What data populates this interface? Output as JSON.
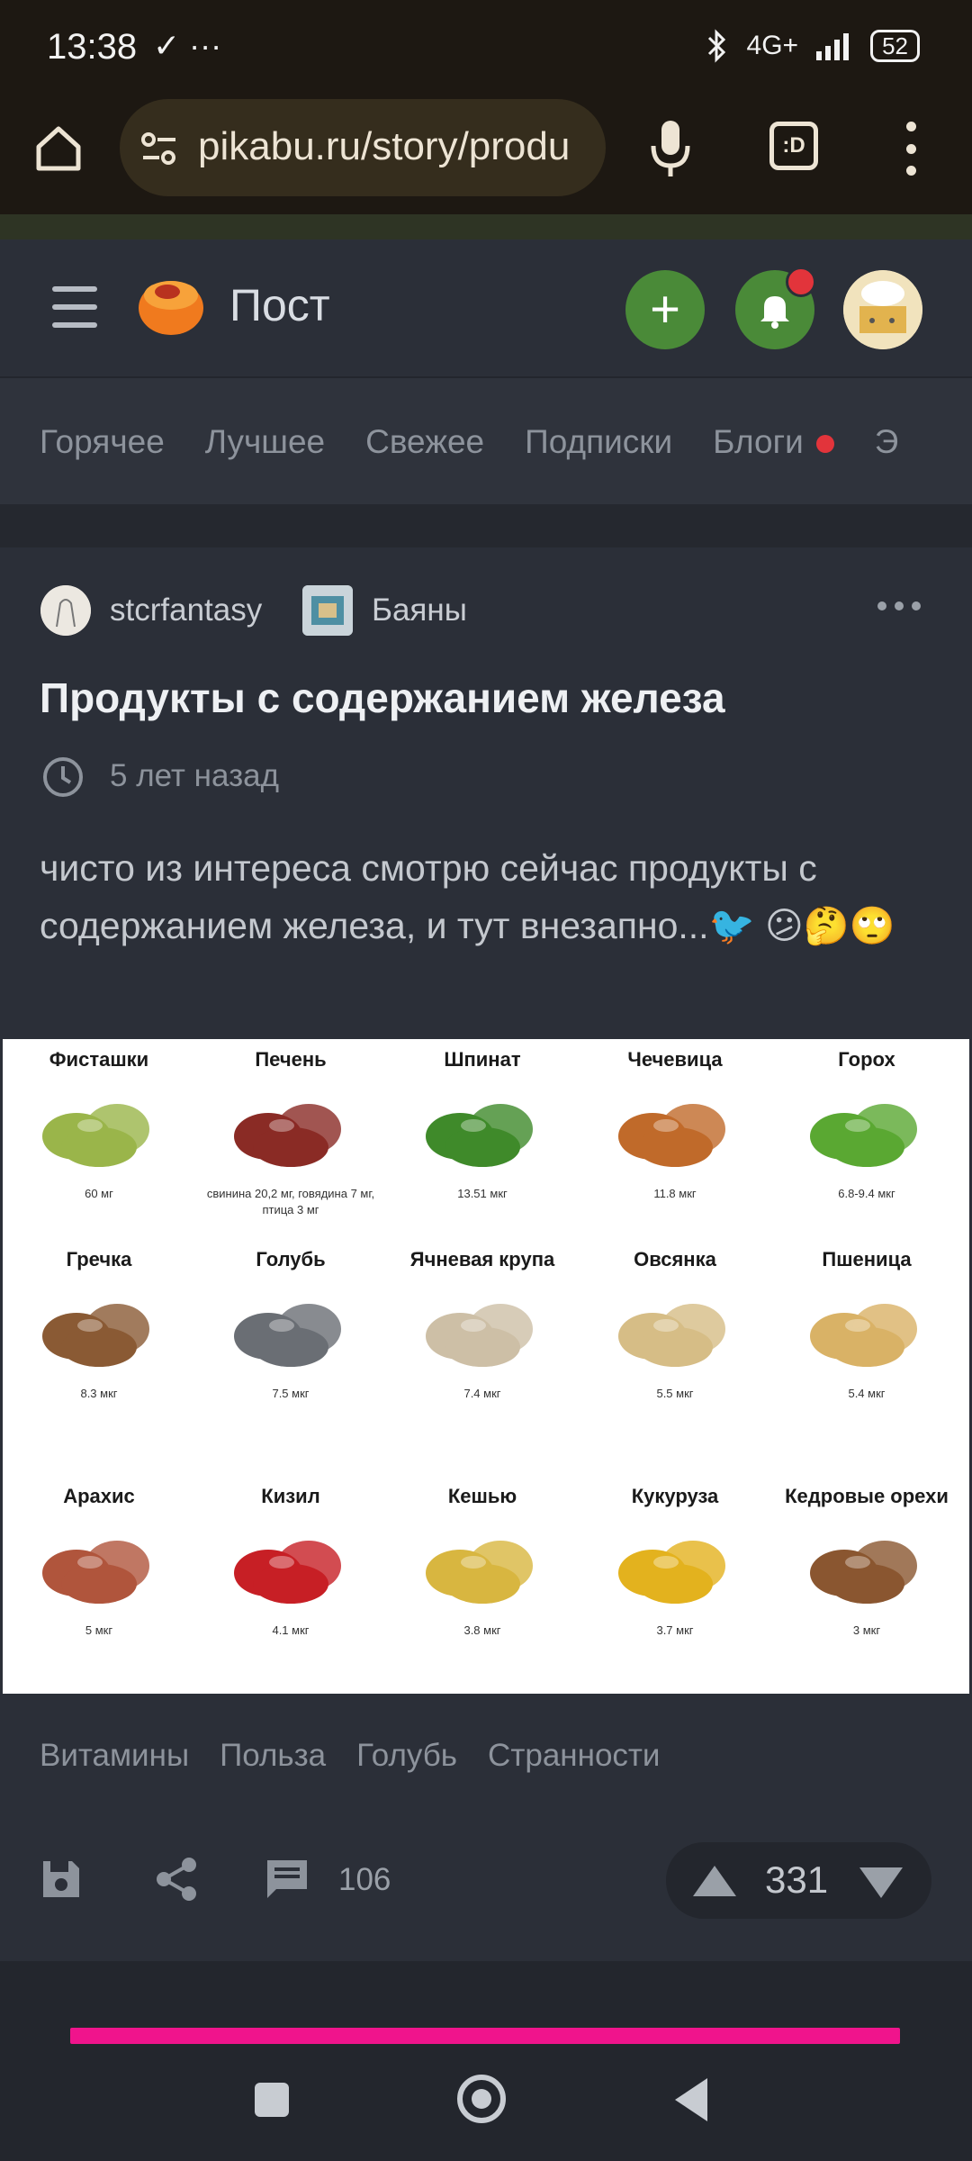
{
  "status_bar": {
    "time": "13:38",
    "misc": "✓ ···",
    "network": "4G+",
    "battery": "52"
  },
  "browser": {
    "url": "pikabu.ru/story/produ"
  },
  "header": {
    "title": "Пост"
  },
  "tabs": [
    "Горячее",
    "Лучшее",
    "Свежее",
    "Подписки",
    "Блоги",
    "Э"
  ],
  "post": {
    "author": "stcrfantasy",
    "community": "Баяны",
    "title": "Продукты с содержанием железа",
    "time": "5 лет назад",
    "text": "чисто из интереса смотрю сейчас продукты с содержанием железа, и тут внезапно...🐦 😕🤔🙄",
    "tags": [
      "Витамины",
      "Польза",
      "Голубь",
      "Странности"
    ],
    "comments": "106",
    "rating": "331"
  },
  "infographic": {
    "items": [
      {
        "name": "Фисташки",
        "value": "60 мг",
        "color": "#9ab54a"
      },
      {
        "name": "Печень",
        "value": "свинина 20,2 мг, говядина 7 мг, птица 3 мг",
        "color": "#8a2b25"
      },
      {
        "name": "Шпинат",
        "value": "13.51 мкг",
        "color": "#3f8a2a"
      },
      {
        "name": "Чечевица",
        "value": "11.8 мкг",
        "color": "#c06a2a"
      },
      {
        "name": "Горох",
        "value": "6.8-9.4 мкг",
        "color": "#5aa832"
      },
      {
        "name": "Гречка",
        "value": "8.3 мкг",
        "color": "#8a5a34"
      },
      {
        "name": "Голубь",
        "value": "7.5 мкг",
        "color": "#6a6e74"
      },
      {
        "name": "Ячневая крупа",
        "value": "7.4 мкг",
        "color": "#cdbfa6"
      },
      {
        "name": "Овсянка",
        "value": "5.5 мкг",
        "color": "#d6bd86"
      },
      {
        "name": "Пшеница",
        "value": "5.4 мкг",
        "color": "#d9b266"
      },
      {
        "name": "Арахис",
        "value": "5 мкг",
        "color": "#b0553c"
      },
      {
        "name": "Кизил",
        "value": "4.1 мкг",
        "color": "#c71f25"
      },
      {
        "name": "Кешью",
        "value": "3.8 мкг",
        "color": "#d8b640"
      },
      {
        "name": "Кукуруза",
        "value": "3.7 мкг",
        "color": "#e3b21e"
      },
      {
        "name": "Кедровые орехи",
        "value": "3 мкг",
        "color": "#8a5630"
      }
    ]
  }
}
